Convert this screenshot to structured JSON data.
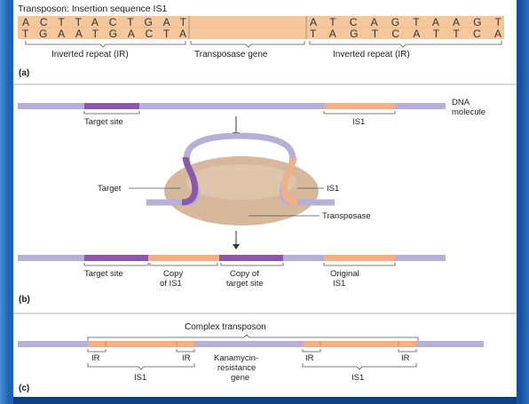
{
  "colors": {
    "frame": "#1f62b4",
    "panel": "#ffffff",
    "seq_band": "#f5c79a",
    "dna": "#b4b0d8",
    "target": "#8a5aa8",
    "is1": "#f2b088",
    "transposase": "#d8b89c"
  },
  "part_a": {
    "title": "Transposon: Insertion sequence IS1",
    "top_left": "ACTTACTGAT",
    "bottom_left": "TGAATGACTA",
    "top_right": "ATCAGTAAGT",
    "bottom_right": "TAGTCATTCA",
    "labels": [
      "Inverted repeat (IR)",
      "Transposase gene",
      "Inverted repeat (IR)"
    ],
    "tag": "(a)"
  },
  "part_b": {
    "dna_label_1": "DNA",
    "dna_label_2": "molecule",
    "target_site": "Target site",
    "is1": "IS1",
    "target": "Target",
    "is1_loop": "IS1",
    "transposase": "Transposase",
    "result_target_site": "Target site",
    "copy_is1_1": "Copy",
    "copy_is1_2": "of IS1",
    "copy_target_1": "Copy of",
    "copy_target_2": "target site",
    "original_1": "Original",
    "original_2": "IS1",
    "tag": "(b)"
  },
  "part_c": {
    "title": "Complex transposon",
    "ir": "IR",
    "kan_1": "Kanamycin-",
    "kan_2": "resistance",
    "kan_3": "gene",
    "is1_left": "IS1",
    "is1_right": "IS1",
    "tag": "(c)"
  }
}
